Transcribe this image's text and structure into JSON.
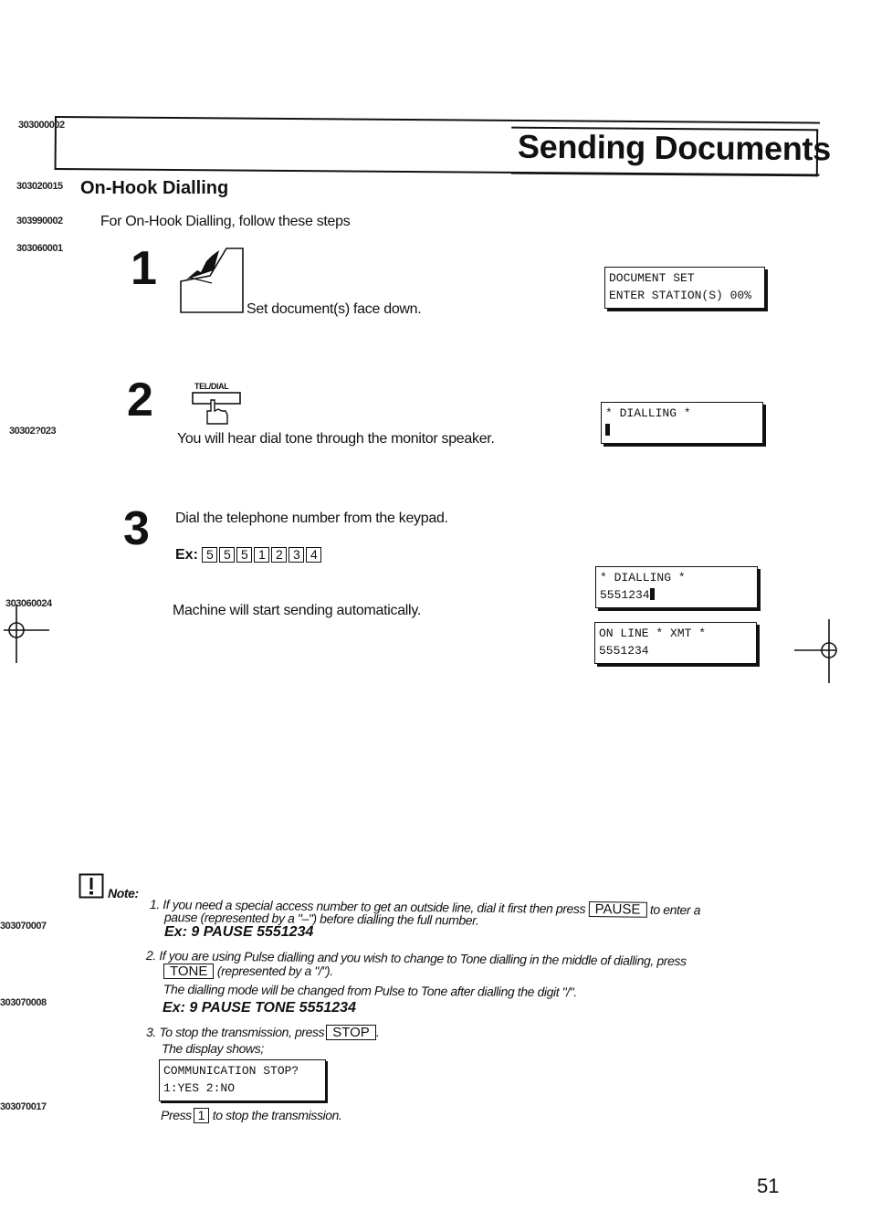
{
  "header": {
    "code": "303000002",
    "title": "Sending Documents"
  },
  "section": {
    "code": "303020015",
    "title": "On-Hook Dialling"
  },
  "intro": {
    "code": "303990002",
    "text": "For On-Hook Dialling, follow these steps"
  },
  "steps": [
    {
      "code": "303060001",
      "number": "1",
      "icon": "document-feeder-icon",
      "text": "Set document(s) face down.",
      "display": [
        "DOCUMENT SET",
        "ENTER STATION(S) 00%"
      ]
    },
    {
      "code": "30302?023",
      "number": "2",
      "button_label": "TEL/DIAL",
      "icon": "hand-press-button-icon",
      "text": "You will hear dial tone through the monitor speaker.",
      "display": [
        "* DIALLING *",
        ""
      ]
    },
    {
      "code": "303060024",
      "number": "3",
      "text": "Dial the telephone number from the keypad.",
      "example_label": "Ex:",
      "example_keys": [
        "5",
        "5",
        "5",
        "1",
        "2",
        "3",
        "4"
      ],
      "followup": "Machine will start sending automatically.",
      "display_dialling": [
        "* DIALLING *",
        "5551234"
      ],
      "display_online": [
        "ON LINE * XMT *",
        "5551234"
      ]
    }
  ],
  "note": {
    "icon": "exclamation-icon",
    "label": "Note:",
    "items": [
      {
        "code": "303070007",
        "num": "1.",
        "line1_before": "If you need a special access number to get an outside line, dial it first then press",
        "button": "PAUSE",
        "line1_after": "to enter a",
        "line2": "pause (represented by a \"–\") before dialling the full number.",
        "example": "Ex: 9 PAUSE 5551234"
      },
      {
        "code": "303070008",
        "num": "2.",
        "line1": "If you are using Pulse dialling and you wish to change to Tone dialling in the middle of dialling, press",
        "button": "TONE",
        "line2_after": "(represented by a \"/\").",
        "line3": "The dialling mode will be changed from Pulse to Tone after dialling the digit \"/\".",
        "example": "Ex: 9 PAUSE TONE 5551234"
      },
      {
        "code": "303070017",
        "num": "3.",
        "line1_before": "To stop the transmission, press",
        "button": "STOP",
        "line1_after": ".",
        "line2": "The display shows;",
        "display": [
          "COMMUNICATION STOP?",
          "1:YES 2:NO"
        ],
        "press_before": "Press",
        "press_key": "1",
        "press_after": "to stop the transmission."
      }
    ]
  },
  "page_number": "51"
}
